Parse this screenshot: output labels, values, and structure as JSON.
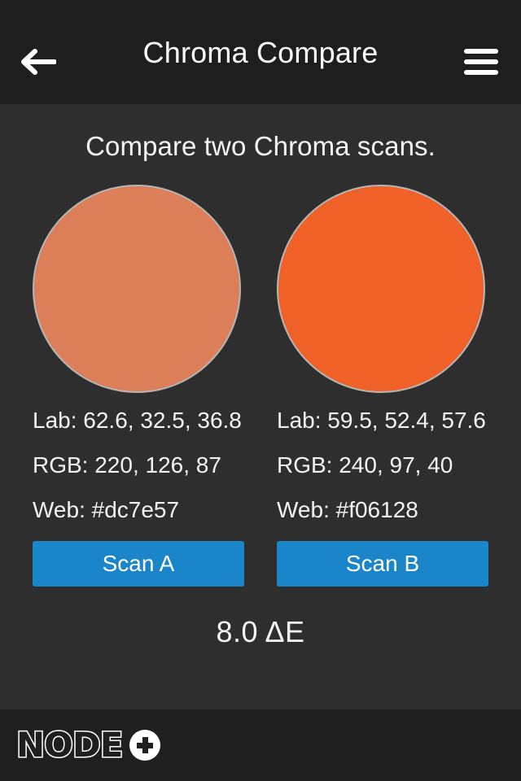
{
  "header": {
    "title": "Chroma Compare",
    "back_icon": "arrow-left-icon",
    "menu_icon": "hamburger-menu-icon"
  },
  "main": {
    "subtitle": "Compare two Chroma scans.",
    "delta_e": "8.0 ΔE",
    "columns": [
      {
        "swatch_color": "#dc7e57",
        "swatch_border_color": "#b5b5b5",
        "lab": "Lab: 62.6, 32.5, 36.8",
        "rgb": "RGB: 220, 126, 87",
        "web": "Web: #dc7e57",
        "button_label": "Scan A"
      },
      {
        "swatch_color": "#f06128",
        "swatch_border_color": "#b5b5b5",
        "lab": "Lab: 59.5, 52.4, 57.6",
        "rgb": "RGB: 240, 97, 40",
        "web": "Web: #f06128",
        "button_label": "Scan B"
      }
    ]
  },
  "footer": {
    "logo_word": "NODE",
    "logo_plus_icon": "plus-circle-icon"
  },
  "colors": {
    "header_bg": "#1f1e1e",
    "content_bg": "#2e2e2e",
    "footer_bg": "#201f1f",
    "button_blue": "#1a85c8",
    "text": "#f2f2f2"
  }
}
